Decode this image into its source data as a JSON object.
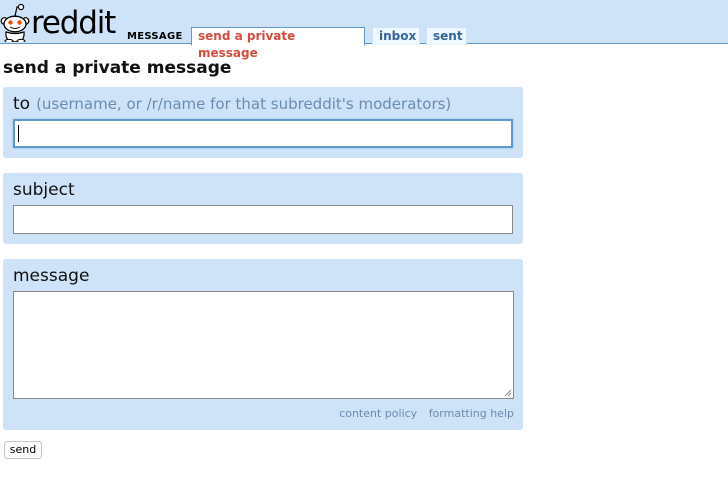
{
  "header": {
    "logo_text": "reddit",
    "section_title": "MESSAGE",
    "tabs": [
      {
        "label": "send a private message",
        "selected": true
      },
      {
        "label": "inbox",
        "selected": false
      },
      {
        "label": "sent",
        "selected": false
      }
    ]
  },
  "page": {
    "title": "send a private message"
  },
  "form": {
    "to": {
      "label": "to",
      "hint": "(username, or /r/name for that subreddit's moderators)",
      "value": ""
    },
    "subject": {
      "label": "subject",
      "value": ""
    },
    "message": {
      "label": "message",
      "value": "",
      "links": [
        "content policy",
        "formatting help"
      ]
    },
    "send_label": "send"
  },
  "colors": {
    "header_bg": "#cee3f8",
    "panel_bg": "#cee3f8",
    "selected_tab_text": "#d64c3c",
    "tab_text": "#336699",
    "hint_text": "#6b8cad"
  }
}
